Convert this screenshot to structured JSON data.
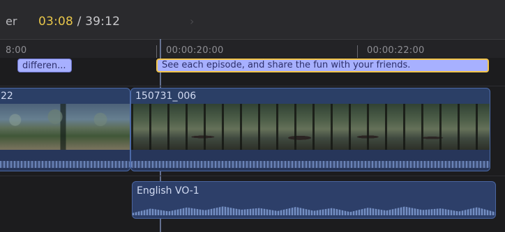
{
  "header": {
    "left_fragment": "er",
    "timecode_current": "03:08",
    "timecode_sep": " / ",
    "timecode_total": "39:12",
    "chevron_icon": "chevron-right-icon"
  },
  "ruler": {
    "labels": [
      "8:00",
      "00:00:20:00",
      "00:00:22:00"
    ]
  },
  "captions": [
    {
      "text": "differen..."
    },
    {
      "text": "See each episode,  and share the fun with your friends."
    }
  ],
  "clips": [
    {
      "title": "22"
    },
    {
      "title": "150731_006"
    }
  ],
  "audio": {
    "title": "English VO-1"
  },
  "colors": {
    "accent": "#e8c64a",
    "caption": "#a7b0ff",
    "clip": "#2b3f66"
  }
}
